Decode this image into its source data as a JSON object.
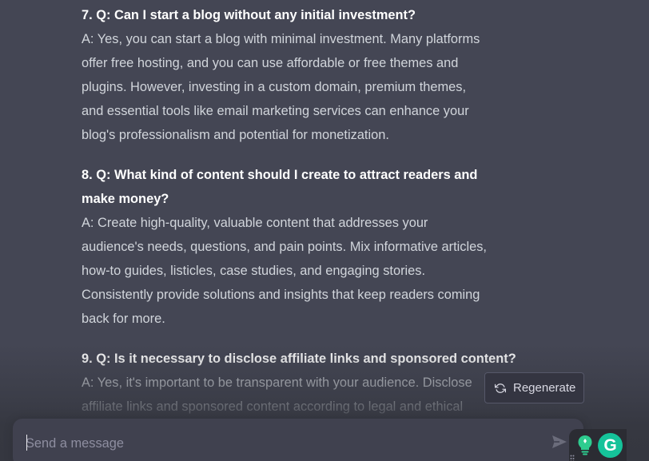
{
  "conversation": {
    "items": [
      {
        "question": "7. Q: Can I start a blog without any initial investment?",
        "answer_lines": [
          "A: Yes, you can start a blog with minimal investment. Many platforms",
          "offer free hosting, and you can use affordable or free themes and",
          "plugins. However, investing in a custom domain, premium themes,",
          "and essential tools like email marketing services can enhance your",
          "blog's professionalism and potential for monetization."
        ]
      },
      {
        "question_lines": [
          "8. Q: What kind of content should I create to attract readers and",
          "make money?"
        ],
        "answer_lines": [
          "A: Create high-quality, valuable content that addresses your",
          "audience's needs, questions, and pain points. Mix informative articles,",
          "how-to guides, listicles, case studies, and engaging stories.",
          "Consistently provide solutions and insights that keep readers coming",
          "back for more."
        ]
      },
      {
        "question": "9. Q: Is it necessary to disclose affiliate links and sponsored content?",
        "answer_lines": [
          "A: Yes, it's important to be transparent with your audience. Disclose",
          "affiliate links and sponsored content according to legal and ethical"
        ]
      }
    ]
  },
  "regenerate": {
    "label": "Regenerate",
    "icon": "refresh-icon"
  },
  "composer": {
    "placeholder": "Send a message",
    "value": "",
    "send_icon": "send-icon"
  },
  "extensions": {
    "bulb_icon": "lightbulb-icon",
    "grammarly_letter": "G",
    "grammarly_color": "#15c39a"
  },
  "colors": {
    "background": "#444654",
    "question_text": "#ffffff",
    "answer_text": "#d1d5db",
    "composer_bg": "#40414f"
  }
}
